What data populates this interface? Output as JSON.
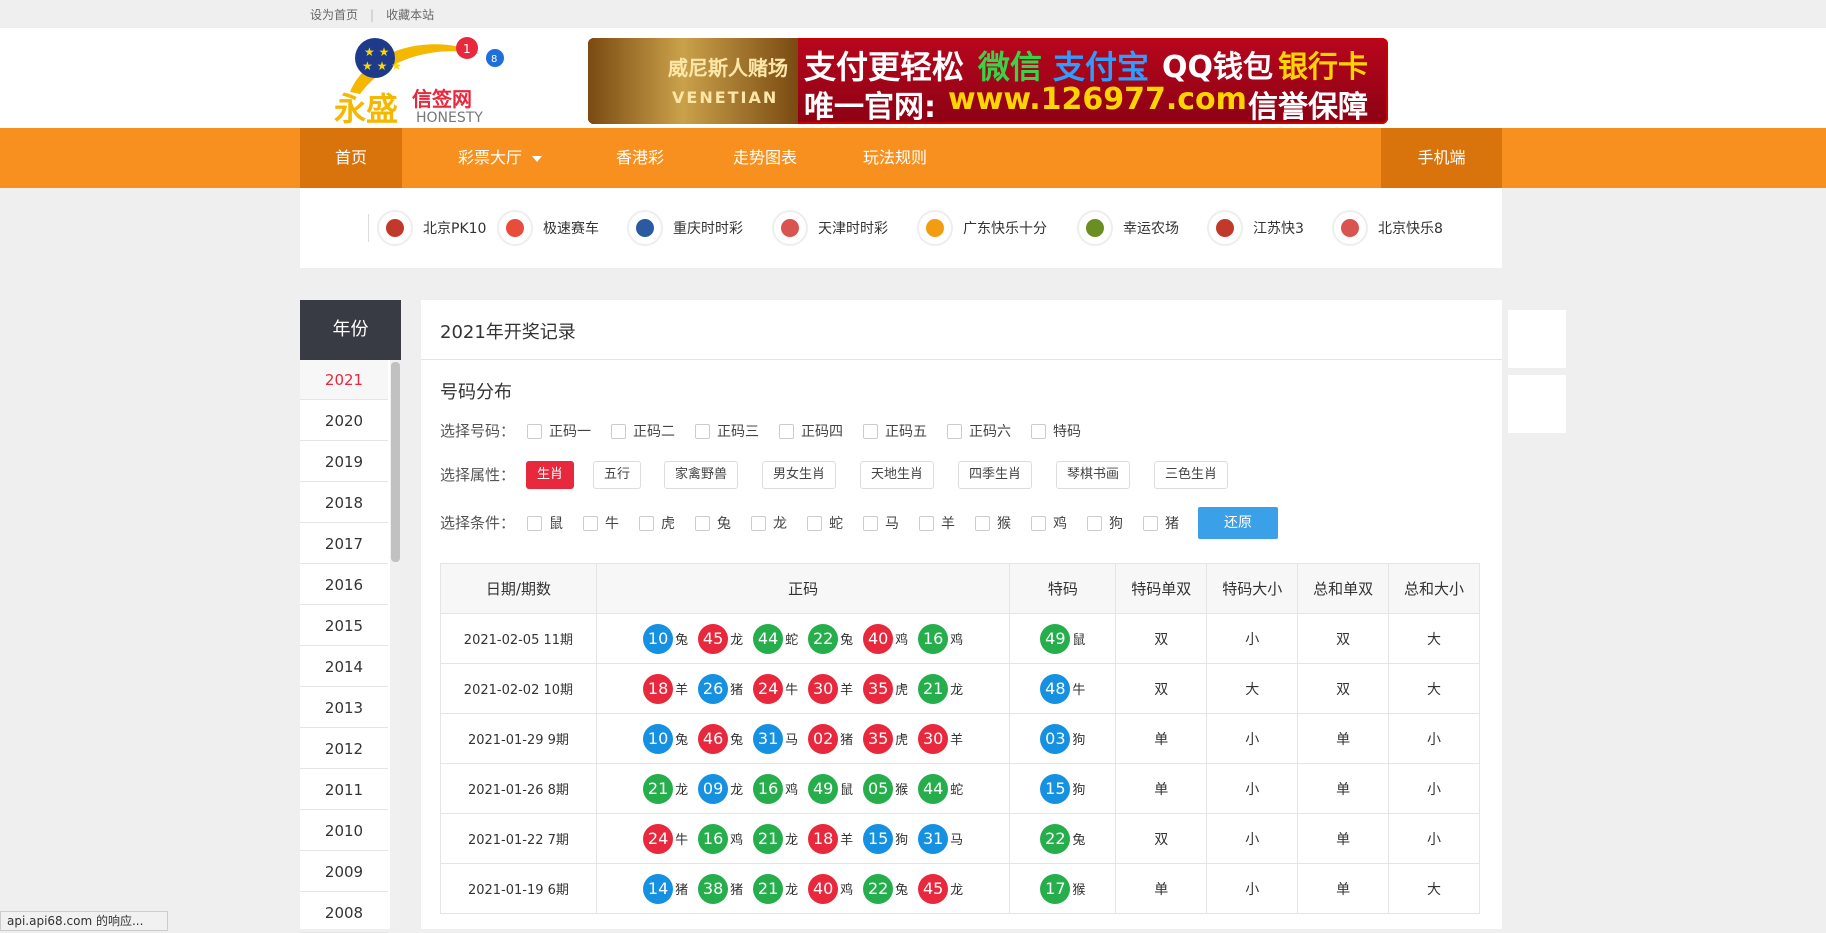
{
  "topbar": {
    "set_home": "设为首页",
    "bookmark": "收藏本站"
  },
  "banner": {
    "casino_name": "威尼斯人赌场",
    "casino_en": "VENETIAN",
    "line1_a": "支付更轻松",
    "line1_wechat": "微信",
    "line1_alipay": "支付宝",
    "line1_qq": "QQ钱包",
    "line1_bank": "银行卡",
    "line2_a": "唯一官网:",
    "line2_url": "www.126977.com",
    "line2_b": "信誉保障"
  },
  "logo": {
    "text_cn": "永盛",
    "text_cn2": "信签网",
    "text_en": "HONESTY"
  },
  "nav": {
    "home": "首页",
    "lottery_hall": "彩票大厅",
    "hk": "香港彩",
    "trend": "走势图表",
    "rules": "玩法规则",
    "mobile": "手机端"
  },
  "lotteries": [
    {
      "label": "北京PK10",
      "color": "#c0392b"
    },
    {
      "label": "极速赛车",
      "color": "#e74c3c"
    },
    {
      "label": "重庆时时彩",
      "color": "#2c5aa0"
    },
    {
      "label": "天津时时彩",
      "color": "#d9534f"
    },
    {
      "label": "广东快乐十分",
      "color": "#f39c12"
    },
    {
      "label": "幸运农场",
      "color": "#6b8e23"
    },
    {
      "label": "江苏快3",
      "color": "#c0392b"
    },
    {
      "label": "北京快乐8",
      "color": "#d9534f"
    }
  ],
  "sidebar": {
    "heading": "年份",
    "years": [
      "2021",
      "2020",
      "2019",
      "2018",
      "2017",
      "2016",
      "2015",
      "2014",
      "2013",
      "2012",
      "2011",
      "2010",
      "2009",
      "2008"
    ],
    "active": "2021"
  },
  "main": {
    "title": "2021年开奖记录",
    "subtitle": "号码分布",
    "select_number_label": "选择号码：",
    "number_options": [
      "正码一",
      "正码二",
      "正码三",
      "正码四",
      "正码五",
      "正码六",
      "特码"
    ],
    "select_attr_label": "选择属性：",
    "attr_options": [
      "生肖",
      "五行",
      "家禽野兽",
      "男女生肖",
      "天地生肖",
      "四季生肖",
      "琴棋书画",
      "三色生肖"
    ],
    "attr_active": "生肖",
    "select_cond_label": "选择条件：",
    "cond_options": [
      "鼠",
      "牛",
      "虎",
      "兔",
      "龙",
      "蛇",
      "马",
      "羊",
      "猴",
      "鸡",
      "狗",
      "猪"
    ],
    "reset": "还原"
  },
  "table": {
    "headers": [
      "日期/期数",
      "正码",
      "特码",
      "特码单双",
      "特码大小",
      "总和单双",
      "总和大小"
    ],
    "rows": [
      {
        "date": "2021-02-05 11期",
        "balls": [
          [
            "10",
            "兔",
            "blue"
          ],
          [
            "45",
            "龙",
            "red"
          ],
          [
            "44",
            "蛇",
            "green"
          ],
          [
            "22",
            "兔",
            "green"
          ],
          [
            "40",
            "鸡",
            "red"
          ],
          [
            "16",
            "鸡",
            "green"
          ]
        ],
        "special": [
          "49",
          "鼠",
          "green"
        ],
        "sp_oe": "双",
        "sp_bs": "小",
        "sum_oe": "双",
        "sum_bs": "大"
      },
      {
        "date": "2021-02-02 10期",
        "balls": [
          [
            "18",
            "羊",
            "red"
          ],
          [
            "26",
            "猪",
            "blue"
          ],
          [
            "24",
            "牛",
            "red"
          ],
          [
            "30",
            "羊",
            "red"
          ],
          [
            "35",
            "虎",
            "red"
          ],
          [
            "21",
            "龙",
            "green"
          ]
        ],
        "special": [
          "48",
          "牛",
          "blue"
        ],
        "sp_oe": "双",
        "sp_bs": "大",
        "sum_oe": "双",
        "sum_bs": "大"
      },
      {
        "date": "2021-01-29 9期",
        "balls": [
          [
            "10",
            "兔",
            "blue"
          ],
          [
            "46",
            "兔",
            "red"
          ],
          [
            "31",
            "马",
            "blue"
          ],
          [
            "02",
            "猪",
            "red"
          ],
          [
            "35",
            "虎",
            "red"
          ],
          [
            "30",
            "羊",
            "red"
          ]
        ],
        "special": [
          "03",
          "狗",
          "blue"
        ],
        "sp_oe": "单",
        "sp_bs": "小",
        "sum_oe": "单",
        "sum_bs": "小"
      },
      {
        "date": "2021-01-26 8期",
        "balls": [
          [
            "21",
            "龙",
            "green"
          ],
          [
            "09",
            "龙",
            "blue"
          ],
          [
            "16",
            "鸡",
            "green"
          ],
          [
            "49",
            "鼠",
            "green"
          ],
          [
            "05",
            "猴",
            "green"
          ],
          [
            "44",
            "蛇",
            "green"
          ]
        ],
        "special": [
          "15",
          "狗",
          "blue"
        ],
        "sp_oe": "单",
        "sp_bs": "小",
        "sum_oe": "单",
        "sum_bs": "小"
      },
      {
        "date": "2021-01-22 7期",
        "balls": [
          [
            "24",
            "牛",
            "red"
          ],
          [
            "16",
            "鸡",
            "green"
          ],
          [
            "21",
            "龙",
            "green"
          ],
          [
            "18",
            "羊",
            "red"
          ],
          [
            "15",
            "狗",
            "blue"
          ],
          [
            "31",
            "马",
            "blue"
          ]
        ],
        "special": [
          "22",
          "兔",
          "green"
        ],
        "sp_oe": "双",
        "sp_bs": "小",
        "sum_oe": "单",
        "sum_bs": "小"
      },
      {
        "date": "2021-01-19 6期",
        "balls": [
          [
            "14",
            "猪",
            "blue"
          ],
          [
            "38",
            "猪",
            "green"
          ],
          [
            "21",
            "龙",
            "green"
          ],
          [
            "40",
            "鸡",
            "red"
          ],
          [
            "22",
            "兔",
            "green"
          ],
          [
            "45",
            "龙",
            "red"
          ]
        ],
        "special": [
          "17",
          "猴",
          "green"
        ],
        "sp_oe": "单",
        "sp_bs": "小",
        "sum_oe": "单",
        "sum_bs": "大"
      }
    ]
  },
  "statusbar": "api.api68.com 的响应..."
}
